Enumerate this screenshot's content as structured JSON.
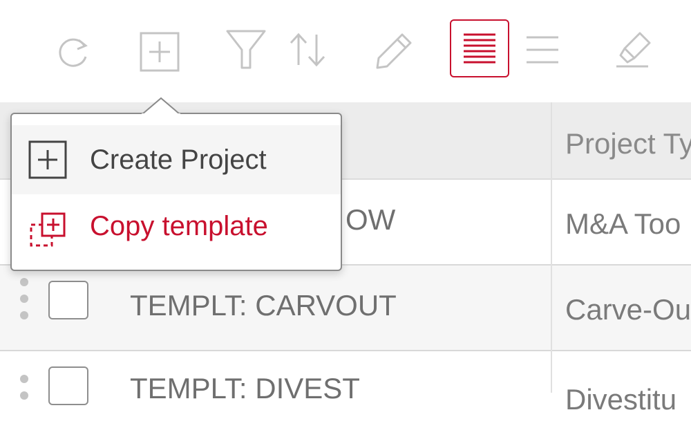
{
  "toolbar": {
    "icons": [
      "refresh-icon",
      "add-icon",
      "filter-icon",
      "sort-icon",
      "edit-icon",
      "list-view-icon",
      "compact-view-icon",
      "highlighter-icon"
    ],
    "active_icon": "list-view-icon"
  },
  "colors": {
    "accent": "#c8102e",
    "icon_gray": "#c4c4c4",
    "text_gray": "#6f6f6f"
  },
  "popover": {
    "items": [
      {
        "label": "Create Project",
        "icon": "add-square-icon",
        "color": "#444444"
      },
      {
        "label": "Copy template",
        "icon": "copy-template-icon",
        "color": "#c8102e"
      }
    ]
  },
  "table": {
    "columns": [
      "",
      "Project Ty"
    ],
    "rows": [
      {
        "name": "TEMPLT: FLOW",
        "name_visible": "OW",
        "type": "M&A Too"
      },
      {
        "name": "TEMPLT: CARVOUT",
        "type": "Carve-Ou"
      },
      {
        "name": "TEMPLT: DIVEST",
        "type": "Divestitu"
      }
    ]
  }
}
